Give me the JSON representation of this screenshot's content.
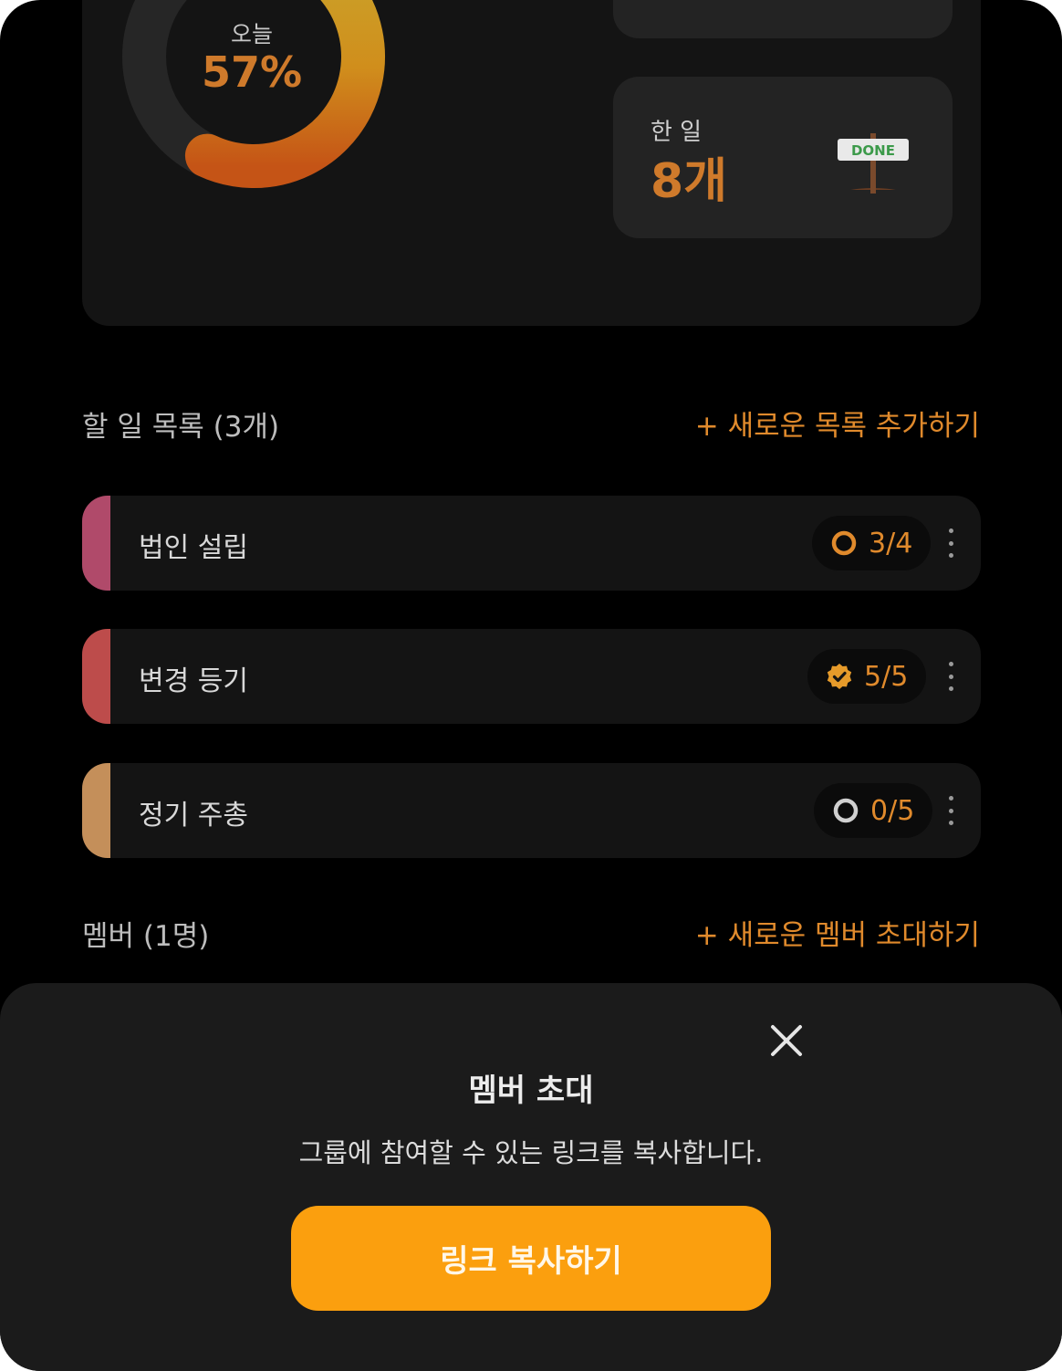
{
  "stats": {
    "donut": {
      "caption": "오늘",
      "value": "57%",
      "progress": 0.57
    },
    "done": {
      "label": "한 일",
      "value": "8개",
      "sign_text": "DONE"
    }
  },
  "tasks_section": {
    "title": "할 일 목록 (3개)",
    "action": "+ 새로운 목록 추가하기",
    "items": [
      {
        "name": "법인 설립",
        "progress": "3/4",
        "status": "in-progress",
        "accent": "#b04a6a"
      },
      {
        "name": "변경 등기",
        "progress": "5/5",
        "status": "complete",
        "accent": "#bd4c4b"
      },
      {
        "name": "정기 주총",
        "progress": "0/5",
        "status": "not-started",
        "accent": "#c48f5a"
      }
    ]
  },
  "members_section": {
    "title": "멤버 (1명)",
    "action": "+ 새로운 멤버 초대하기"
  },
  "invite_sheet": {
    "title": "멤버 초대",
    "description": "그룹에 참여할 수 있는 링크를 복사합니다.",
    "button_label": "링크 복사하기"
  },
  "colors": {
    "accent_orange": "#e08a2c",
    "button_orange": "#fb9f0e",
    "background": "#000000",
    "card": "#141414"
  }
}
